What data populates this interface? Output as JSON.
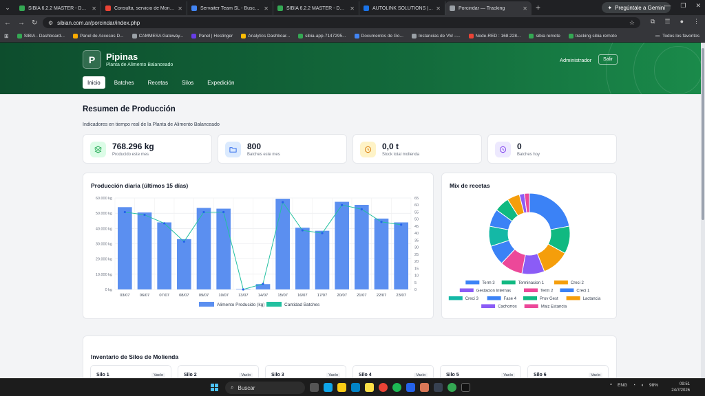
{
  "browser": {
    "tabs": [
      {
        "title": "SIBIA 6.2.2 MASTER - Dashboa",
        "favcolor": "#34a853"
      },
      {
        "title": "Consulta, servicio de Monitoreo",
        "favcolor": "#ea4335"
      },
      {
        "title": "Servaiter Team SL - Buscar con",
        "favcolor": "#4285f4"
      },
      {
        "title": "SIBIA 6.2.2 MASTER - Dashboa",
        "favcolor": "#34a853"
      },
      {
        "title": "AUTOLINK SOLUTIONS | Autom",
        "favcolor": "#1a73e8"
      },
      {
        "title": "Porcindar — Tracking",
        "favcolor": "#9aa0a6"
      }
    ],
    "gemini_label": "Pregúntale a Gemini",
    "url": "sibian.com.ar/porcindar/index.php",
    "bookmarks": [
      {
        "label": "SIBIA - Dashboard...",
        "color": "#34a853"
      },
      {
        "label": "Panel de Accesos D...",
        "color": "#f9ab00"
      },
      {
        "label": "CAMMESA Gateway...",
        "color": "#9aa0a6"
      },
      {
        "label": "Panel | Hostinger",
        "color": "#673de6"
      },
      {
        "label": "Analytics Dashboar...",
        "color": "#fbbc04"
      },
      {
        "label": "sibia-app-7147295...",
        "color": "#34a853"
      },
      {
        "label": "Documentos de Go...",
        "color": "#4285f4"
      },
      {
        "label": "Instancias de VM –...",
        "color": "#9aa0a6"
      },
      {
        "label": "Node-RED : 168.228...",
        "color": "#ea4335"
      },
      {
        "label": "sibia remote",
        "color": "#34a853"
      },
      {
        "label": "tracking sibia remoto",
        "color": "#34a853"
      }
    ],
    "all_bookmarks": "Todos los favoritos"
  },
  "header": {
    "logo_letter": "P",
    "brand": "Pipinas",
    "brand_sub": "Planta de Alimento Balanceado",
    "user": "Administrador",
    "logout": "Salir",
    "nav": [
      "Inicio",
      "Batches",
      "Recetas",
      "Silos",
      "Expedición"
    ]
  },
  "main": {
    "title": "Resumen de Producción",
    "subtitle": "Indicadores en tiempo real de la Planta de Alimento Balanceado"
  },
  "stats": [
    {
      "value": "768.296 kg",
      "label": "Producido este mes",
      "icon": "layers-icon",
      "bg": "#dcfce7",
      "color": "#16a34a"
    },
    {
      "value": "800",
      "label": "Batches este mes",
      "icon": "folder-icon",
      "bg": "#dbeafe",
      "color": "#2563eb"
    },
    {
      "value": "0,0 t",
      "label": "Stock total molienda",
      "icon": "clock-icon",
      "bg": "#fef3c7",
      "color": "#d97706"
    },
    {
      "value": "0",
      "label": "Batches hoy",
      "icon": "clock-icon",
      "bg": "#ede9fe",
      "color": "#7c3aed"
    }
  ],
  "chart_data": [
    {
      "type": "bar",
      "title": "Producción diaria (últimos 15 días)",
      "categories": [
        "03/07",
        "06/07",
        "07/07",
        "08/07",
        "09/07",
        "10/07",
        "13/07",
        "14/07",
        "15/07",
        "16/07",
        "17/07",
        "20/07",
        "21/07",
        "22/07",
        "23/07"
      ],
      "series": [
        {
          "name": "Alimento Producido (kg)",
          "type": "bar",
          "color": "#5b8ff0",
          "axis": "left",
          "values": [
            54000,
            50500,
            44000,
            33000,
            53500,
            53000,
            300,
            3500,
            59500,
            40500,
            38500,
            57500,
            55500,
            46500,
            44000
          ]
        },
        {
          "name": "Cantidad Batches",
          "type": "line",
          "color": "#22c0a0",
          "axis": "right",
          "values": [
            55,
            53,
            47,
            34,
            55,
            55,
            0,
            4,
            62,
            42,
            40,
            60,
            57,
            48,
            46
          ]
        }
      ],
      "left_ticks": [
        "0 kg",
        "10.000 kg",
        "20.000 kg",
        "30.000 kg",
        "40.000 kg",
        "50.000 kg",
        "60.000 kg"
      ],
      "ylim": [
        0,
        60000
      ],
      "right_ticks": [
        "0",
        "5",
        "10",
        "15",
        "20",
        "25",
        "30",
        "35",
        "40",
        "45",
        "50",
        "55",
        "60",
        "65"
      ],
      "y2lim": [
        0,
        65
      ],
      "grid": true,
      "legend": "bottom"
    },
    {
      "type": "pie",
      "title": "Mix de recetas",
      "slices": [
        {
          "label": "Term 3",
          "value": 22,
          "color": "#3b82f6"
        },
        {
          "label": "Terminacion 1",
          "value": 11,
          "color": "#10b981"
        },
        {
          "label": "Creci 2",
          "value": 11,
          "color": "#f59e0b"
        },
        {
          "label": "Gestacion Internas",
          "value": 9,
          "color": "#8b5cf6"
        },
        {
          "label": "Term 2",
          "value": 9,
          "color": "#ec4899"
        },
        {
          "label": "Creci 1",
          "value": 8,
          "color": "#3b82f6"
        },
        {
          "label": "Creci 3",
          "value": 8,
          "color": "#14b8a6"
        },
        {
          "label": "Fase 4",
          "value": 7,
          "color": "#3b82f6"
        },
        {
          "label": "Prov Gest",
          "value": 6,
          "color": "#10b981"
        },
        {
          "label": "Lactancia",
          "value": 5,
          "color": "#f59e0b"
        },
        {
          "label": "Cachorros",
          "value": 2,
          "color": "#8b5cf6"
        },
        {
          "label": "Maiz Estancia",
          "value": 2,
          "color": "#ec4899"
        }
      ],
      "legend": "bottom"
    }
  ],
  "silos": {
    "title": "Inventario de Silos de Molienda",
    "items": [
      {
        "name": "Silo 1",
        "status": "Vacío"
      },
      {
        "name": "Silo 2",
        "status": "Vacío"
      },
      {
        "name": "Silo 3",
        "status": "Vacío"
      },
      {
        "name": "Silo 4",
        "status": "Vacío"
      },
      {
        "name": "Silo 5",
        "status": "Vacío"
      },
      {
        "name": "Silo 6",
        "status": "Vacío"
      }
    ]
  },
  "taskbar": {
    "search": "Buscar",
    "lang": "ENG",
    "battery": "98%",
    "time": "09:51",
    "date": "24/7/2026"
  }
}
